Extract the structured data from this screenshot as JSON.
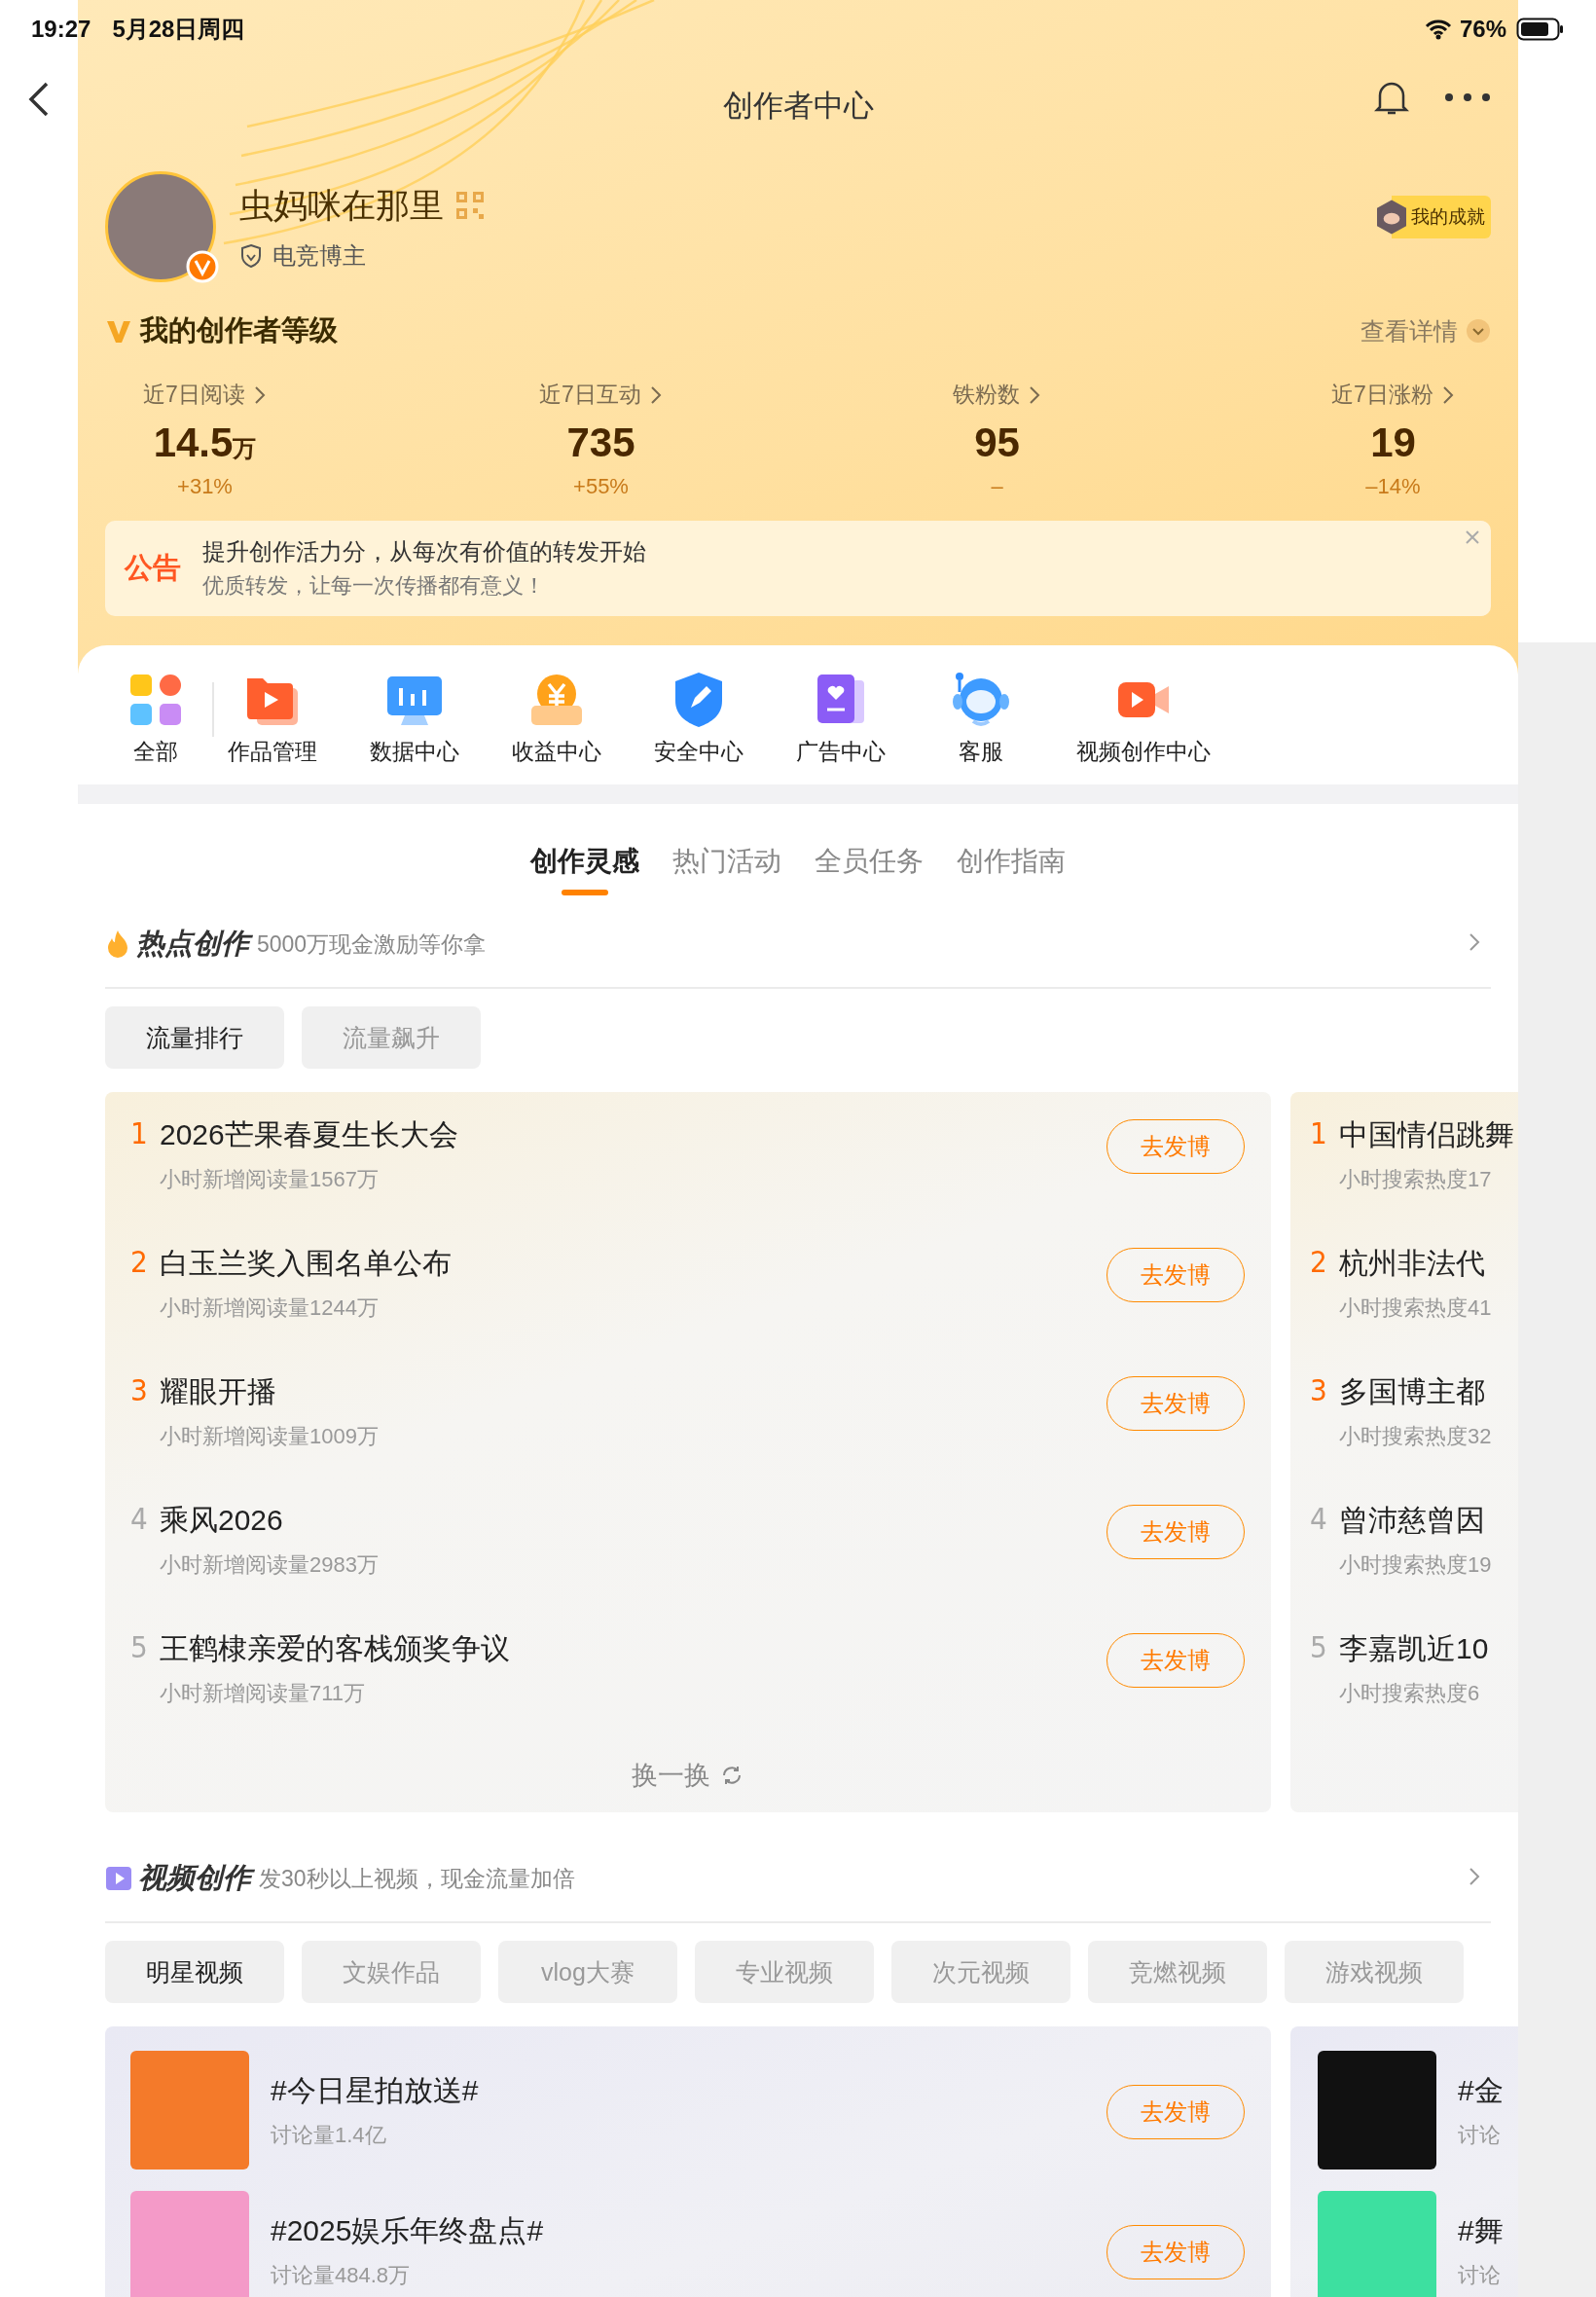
{
  "status_bar": {
    "time": "19:27",
    "date": "5月28日周四",
    "battery": "76%"
  },
  "nav": {
    "title": "创作者中心"
  },
  "profile": {
    "name": "虫妈咪在那里",
    "tag": "电竞博主",
    "achievement": "我的成就"
  },
  "level": {
    "title": "我的创作者等级",
    "link": "查看详情"
  },
  "stats": [
    {
      "label": "近7日阅读",
      "value": "14.5",
      "unit": "万",
      "change": "+31%"
    },
    {
      "label": "近7日互动",
      "value": "735",
      "change": "+55%"
    },
    {
      "label": "铁粉数",
      "value": "95",
      "change": "–"
    },
    {
      "label": "近7日涨粉",
      "value": "19",
      "change": "–14%"
    }
  ],
  "notice": {
    "badge": "公告",
    "title": "提升创作活力分，从每次有价值的转发开始",
    "subtitle": "优质转发，让每一次传播都有意义！"
  },
  "shortcuts": [
    {
      "label": "全部",
      "kind": "grid"
    },
    {
      "label": "作品管理",
      "kind": "folder"
    },
    {
      "label": "数据中心",
      "kind": "monitor"
    },
    {
      "label": "收益中心",
      "kind": "coin"
    },
    {
      "label": "安全中心",
      "kind": "shield"
    },
    {
      "label": "广告中心",
      "kind": "book"
    },
    {
      "label": "客服",
      "kind": "headset"
    },
    {
      "label": "视频创作中心",
      "kind": "camera"
    }
  ],
  "tabs": [
    {
      "label": "创作灵感",
      "selected": true
    },
    {
      "label": "热门活动",
      "selected": false
    },
    {
      "label": "全员任务",
      "selected": false
    },
    {
      "label": "创作指南",
      "selected": false
    }
  ],
  "hot": {
    "title": "热点创作",
    "subtitle": "5000万现金激励等你拿",
    "filters": [
      {
        "label": "流量排行",
        "selected": true
      },
      {
        "label": "流量飙升",
        "selected": false
      }
    ],
    "cards": [
      {
        "items": [
          {
            "rank": "1",
            "highlight": true,
            "title": "2026芒果春夏生长大会",
            "stat": "小时新增阅读量1567万",
            "action": "去发博"
          },
          {
            "rank": "2",
            "highlight": true,
            "title": "白玉兰奖入围名单公布",
            "stat": "小时新增阅读量1244万",
            "action": "去发博"
          },
          {
            "rank": "3",
            "highlight": true,
            "title": "耀眼开播",
            "stat": "小时新增阅读量1009万",
            "action": "去发博"
          },
          {
            "rank": "4",
            "highlight": false,
            "title": "乘风2026",
            "stat": "小时新增阅读量2983万",
            "action": "去发博"
          },
          {
            "rank": "5",
            "highlight": false,
            "title": "王鹤棣亲爱的客栈颁奖争议",
            "stat": "小时新增阅读量711万",
            "action": "去发博"
          }
        ],
        "refresh": "换一换"
      },
      {
        "items": [
          {
            "rank": "1",
            "highlight": true,
            "title": "中国情侣跳舞",
            "stat": "小时搜索热度17"
          },
          {
            "rank": "2",
            "highlight": true,
            "title": "杭州非法代",
            "stat": "小时搜索热度41"
          },
          {
            "rank": "3",
            "highlight": true,
            "title": "多国博主都",
            "stat": "小时搜索热度32"
          },
          {
            "rank": "4",
            "highlight": false,
            "title": "曾沛慈曾因",
            "stat": "小时搜索热度19"
          },
          {
            "rank": "5",
            "highlight": false,
            "title": "李嘉凯近10",
            "stat": "小时搜索热度6"
          }
        ]
      }
    ]
  },
  "video": {
    "title": "视频创作",
    "subtitle": "发30秒以上视频，现金流量加倍",
    "filters": [
      {
        "label": "明星视频",
        "selected": true
      },
      {
        "label": "文娱作品",
        "selected": false
      },
      {
        "label": "vlog大赛",
        "selected": false
      },
      {
        "label": "专业视频",
        "selected": false
      },
      {
        "label": "次元视频",
        "selected": false
      },
      {
        "label": "竞燃视频",
        "selected": false
      },
      {
        "label": "游戏视频",
        "selected": false
      }
    ],
    "cards": [
      {
        "items": [
          {
            "title": "#今日星拍放送#",
            "stat": "讨论量1.4亿",
            "action": "去发博",
            "color": "#f47a2a"
          },
          {
            "title": "#2025娱乐年终盘点#",
            "stat": "讨论量484.8万",
            "action": "去发博",
            "color": "#f49ac8"
          }
        ]
      },
      {
        "items": [
          {
            "title": "#金",
            "stat": "讨论",
            "color": "#111111"
          },
          {
            "title": "#舞",
            "stat": "讨论",
            "color": "#3de0a0"
          }
        ]
      }
    ]
  }
}
